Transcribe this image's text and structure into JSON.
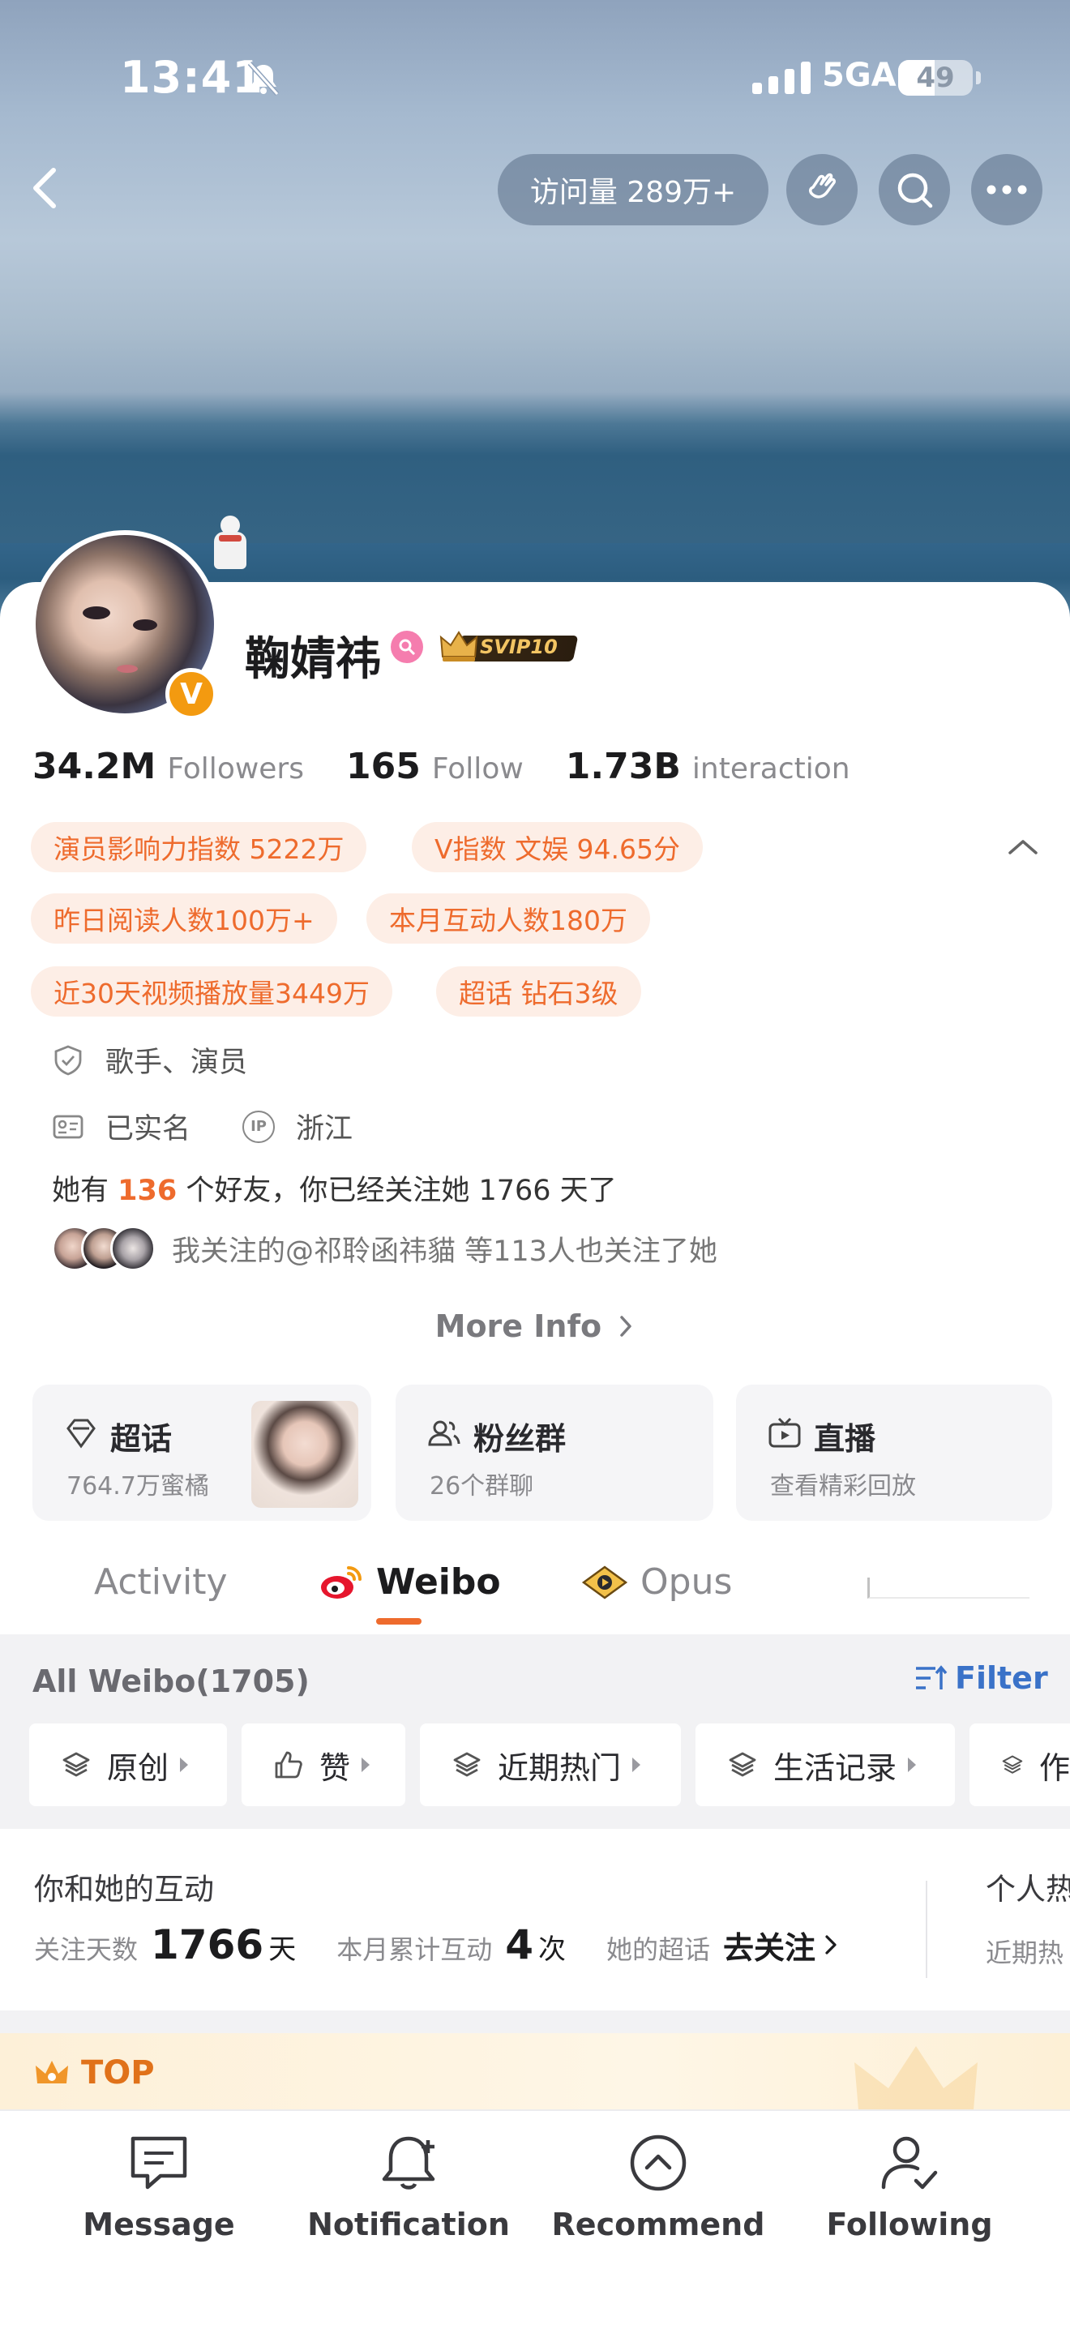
{
  "status_bar": {
    "time": "13:41",
    "network": "5GA",
    "battery": "49",
    "battery_level": 0.49
  },
  "header": {
    "visits": "访问量 289万+"
  },
  "profile": {
    "name": "鞠婧祎",
    "svip": "SVIP10",
    "verified_mark": "V",
    "stats": [
      {
        "value": "34.2M",
        "label": "Followers"
      },
      {
        "value": "165",
        "label": "Follow"
      },
      {
        "value": "1.73B",
        "label": "interaction"
      }
    ],
    "tags": [
      "演员影响力指数 5222万",
      "V指数 文娱 94.65分",
      "昨日阅读人数100万+",
      "本月互动人数180万",
      "近30天视频播放量3449万",
      "超话 钻石3级"
    ],
    "occupation": "歌手、演员",
    "realname": "已实名",
    "ip_label": "IP",
    "ip_location": "浙江",
    "friends": {
      "prefix": "她有 ",
      "count": "136",
      "suffix": " 个好友，你已经关注她 1766 天了"
    },
    "mutual_follow": "我关注的@祁聆函祎貓 等113人也关注了她",
    "more_info": "More Info"
  },
  "feature_cards": [
    {
      "title": "超话",
      "sub": "764.7万蜜橘"
    },
    {
      "title": "粉丝群",
      "sub": "26个群聊"
    },
    {
      "title": "直播",
      "sub": "查看精彩回放"
    }
  ],
  "tabs": [
    {
      "label": "Activity"
    },
    {
      "label": "Weibo"
    },
    {
      "label": "Opus"
    }
  ],
  "feed": {
    "all_weibo": "All Weibo(1705)",
    "filter": "Filter",
    "chips": [
      "原创",
      "赞",
      "近期热门",
      "生活记录",
      "作"
    ]
  },
  "interaction": {
    "title": "你和她的互动",
    "follow_days_label": "关注天数",
    "follow_days_value": "1766",
    "follow_days_unit": "天",
    "month_label": "本月累计互动",
    "month_value": "4",
    "month_unit": "次",
    "super_label": "她的超话",
    "super_action": "去关注",
    "side_title": "个人热",
    "side_sub": "近期热"
  },
  "top_strip": {
    "label": "TOP"
  },
  "bottom_bar": [
    {
      "label": "Message",
      "icon": "message-icon"
    },
    {
      "label": "Notification",
      "icon": "bell-plus-icon"
    },
    {
      "label": "Recommend",
      "icon": "chevron-up-circle-icon"
    },
    {
      "label": "Following",
      "icon": "user-check-icon"
    }
  ],
  "colors": {
    "accent": "#ee6b2d",
    "tag_bg": "#fdeee6",
    "filter_blue": "#3a72c8",
    "verified": "#f39a10"
  }
}
